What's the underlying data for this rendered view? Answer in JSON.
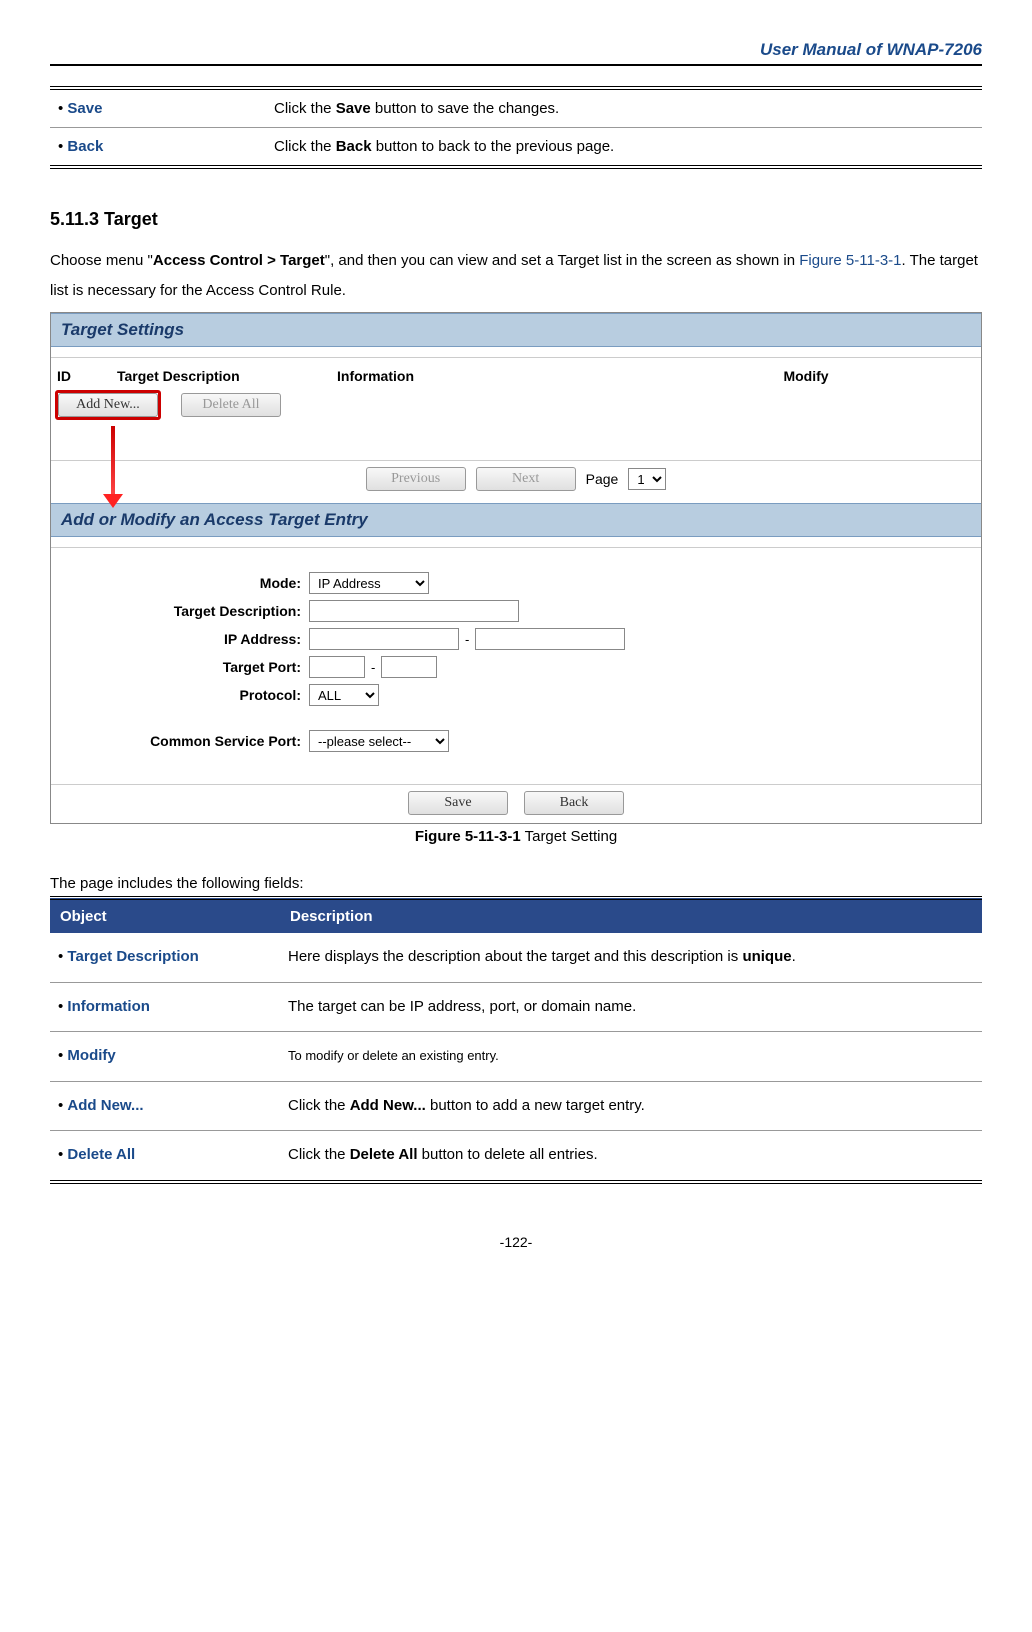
{
  "header_title": "User Manual of WNAP-7206",
  "top_table": {
    "rows": [
      {
        "obj": "Save",
        "desc_pre": "Click the ",
        "desc_bold": "Save",
        "desc_post": " button to save the changes."
      },
      {
        "obj": "Back",
        "desc_pre": "Click the ",
        "desc_bold": "Back",
        "desc_post": " button to back to the previous page."
      }
    ]
  },
  "section_title": "5.11.3 Target",
  "intro": {
    "t1": "Choose menu \"",
    "bold1": "Access Control > Target",
    "t2": "\", and then you can view and set a Target list in the screen as shown in ",
    "figref": "Figure 5-11-3-1",
    "t3": ". The target list is necessary for the Access Control Rule."
  },
  "figure": {
    "panel1_title": "Target Settings",
    "th_id": "ID",
    "th_desc": "Target Description",
    "th_info": "Information",
    "th_mod": "Modify",
    "btn_addnew": "Add New...",
    "btn_deleteall": "Delete All",
    "btn_previous": "Previous",
    "btn_next": "Next",
    "page_label": "Page",
    "page_value": "1",
    "panel2_title": "Add or Modify an Access Target Entry",
    "lbl_mode": "Mode:",
    "val_mode": "IP Address",
    "lbl_tdesc": "Target Description:",
    "lbl_ip": "IP Address:",
    "lbl_port": "Target Port:",
    "lbl_proto": "Protocol:",
    "val_proto": "ALL",
    "lbl_csp": "Common Service Port:",
    "val_csp": "--please select--",
    "btn_save": "Save",
    "btn_back": "Back"
  },
  "figure_caption": {
    "bold": "Figure 5-11-3-1",
    "rest": " Target Setting"
  },
  "fields_intro": "The page includes the following fields:",
  "fields_table": {
    "th_obj": "Object",
    "th_desc": "Description",
    "rows": [
      {
        "obj": "Target Description",
        "desc_pre": "Here displays the description about the target and this description is ",
        "desc_bold": "unique",
        "desc_post": ".",
        "small": false
      },
      {
        "obj": "Information",
        "desc_pre": "The target can be IP address, port, or domain name.",
        "desc_bold": "",
        "desc_post": "",
        "small": false
      },
      {
        "obj": "Modify",
        "desc_pre": "To modify or delete an existing entry.",
        "desc_bold": "",
        "desc_post": "",
        "small": true
      },
      {
        "obj": "Add New...",
        "desc_pre": "Click the ",
        "desc_bold": "Add New...",
        "desc_post": " button to add a new target entry.",
        "small": false
      },
      {
        "obj": "Delete All",
        "desc_pre": "Click the ",
        "desc_bold": "Delete All",
        "desc_post": " button to delete all entries.",
        "small": false
      }
    ]
  },
  "page_number": "-122-"
}
